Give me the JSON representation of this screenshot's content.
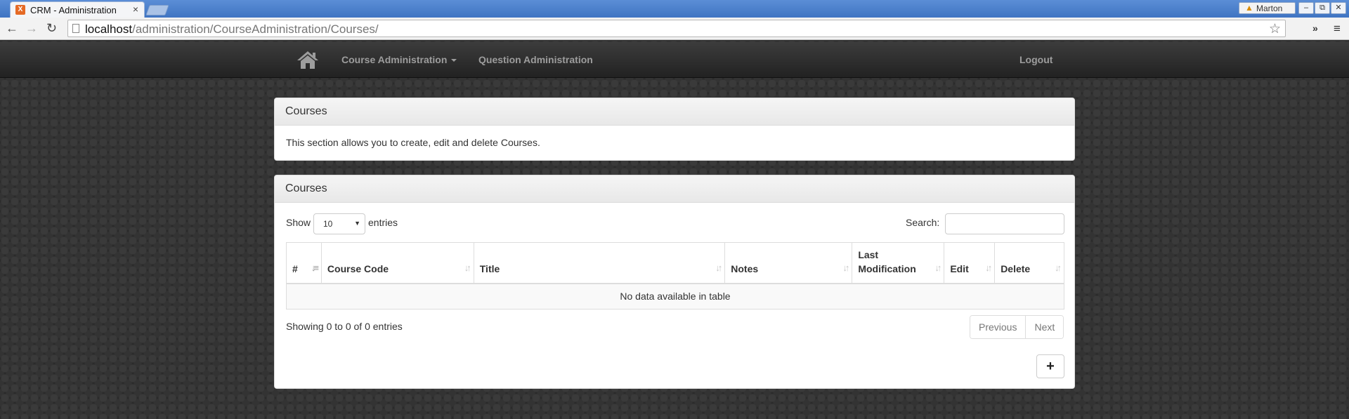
{
  "browser": {
    "tab_title": "CRM - Administration",
    "tab_favicon": "X",
    "tab_close": "×",
    "profile_name": "Marton",
    "url_host": "localhost",
    "url_path": "/administration/CourseAdministration/Courses/",
    "win_minimize": "–",
    "win_restore": "⧉",
    "win_close": "✕",
    "back_icon": "←",
    "forward_icon": "→",
    "reload_icon": "↻",
    "star_icon": "☆",
    "chevrons": "»",
    "menu_icon": "≡"
  },
  "navbar": {
    "course_admin": "Course Administration",
    "question_admin": "Question Administration",
    "logout": "Logout"
  },
  "intro_panel": {
    "heading": "Courses",
    "text": "This section allows you to create, edit and delete Courses."
  },
  "list_panel": {
    "heading": "Courses",
    "show_label": "Show",
    "length_value": "10",
    "entries_label": "entries",
    "search_label": "Search:",
    "columns": [
      {
        "label": "#"
      },
      {
        "label": "Course Code"
      },
      {
        "label": "Title"
      },
      {
        "label": "Notes"
      },
      {
        "label": "Last Modification"
      },
      {
        "label": "Edit"
      },
      {
        "label": "Delete"
      }
    ],
    "empty_message": "No data available in table",
    "info": "Showing 0 to 0 of 0 entries",
    "previous": "Previous",
    "next": "Next",
    "add_icon": "+"
  }
}
